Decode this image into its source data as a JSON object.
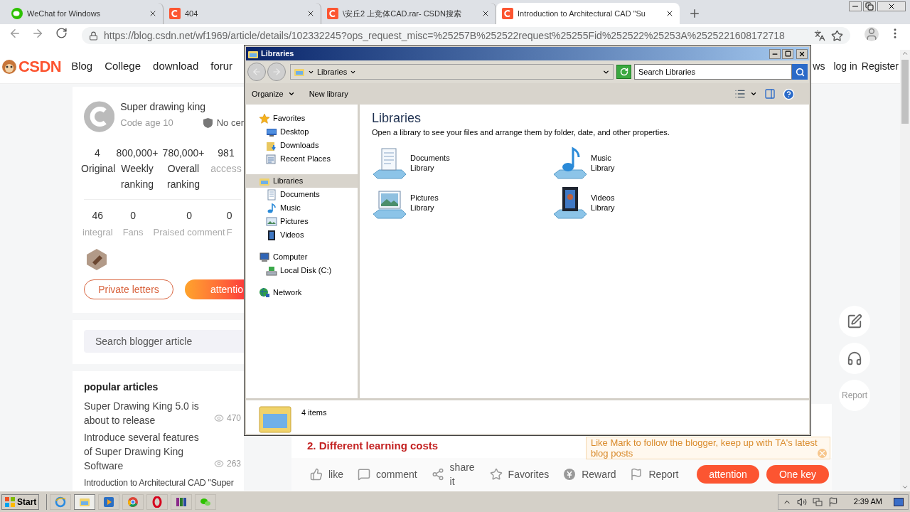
{
  "browser": {
    "tabs": [
      {
        "title": "WeChat for Windows",
        "kind": "wechat",
        "selected": false
      },
      {
        "title": "404",
        "kind": "csdn",
        "selected": false
      },
      {
        "title": "\\安丘2 上竞体CAD.rar- CSDN搜索",
        "kind": "csdn",
        "selected": false
      },
      {
        "title": "Introduction to Architectural CAD \"Su",
        "kind": "csdn",
        "selected": true
      }
    ],
    "address": "https://blog.csdn.net/wf1969/article/details/102332245?ops_request_misc=%25257B%252522request%25255Fid%252522%25253A%2525221608172718"
  },
  "site_header": {
    "logo": "CSDN",
    "nav": [
      "Blog",
      "College",
      "download",
      "forur"
    ],
    "right": [
      "ws",
      "log in",
      "Register"
    ]
  },
  "profile": {
    "name": "Super drawing king",
    "code_age": "Code age 10",
    "certification": "No cer",
    "stats": [
      {
        "value": "4",
        "label": "Original"
      },
      {
        "value": "800,000+",
        "label": "Weekly ranking"
      },
      {
        "value": "780,000+",
        "label": "Overall ranking"
      },
      {
        "value": "981",
        "label": "access"
      }
    ],
    "stats2": [
      {
        "value": "46",
        "label": "integral"
      },
      {
        "value": "0",
        "label": "Fans"
      },
      {
        "value": "0",
        "label": "Praised comment"
      },
      {
        "value": "0",
        "label": "F"
      }
    ],
    "buttons": [
      "Private letters",
      "attentio"
    ]
  },
  "blogger_search": {
    "placeholder": "Search blogger article"
  },
  "popular_articles": {
    "title": "popular articles",
    "items": [
      {
        "title": "Super Drawing King 5.0 is about to release",
        "views": "470"
      },
      {
        "title": "Introduce several features of Super Drawing King Software",
        "views": "263"
      },
      {
        "title": "Introduction to Architectural CAD \"Super"
      }
    ]
  },
  "article": {
    "heading": "2. Different learning costs",
    "tip": "Like Mark to follow the blogger, keep up with TA's latest blog posts",
    "actions": [
      {
        "label": "like",
        "kind": "like"
      },
      {
        "label": "comment",
        "kind": "comment"
      },
      {
        "label": "share it",
        "kind": "share"
      },
      {
        "label": "Favorites",
        "kind": "favorites"
      },
      {
        "label": "Reward",
        "kind": "reward"
      },
      {
        "label": "Report",
        "kind": "report"
      }
    ],
    "buttons": [
      "attention",
      "One key"
    ]
  },
  "right_rail": {
    "report": "Report"
  },
  "explorer": {
    "title": "Libraries",
    "breadcrumb": "Libraries",
    "search": {
      "placeholder": "Search Libraries"
    },
    "toolbar": [
      "Organize",
      "New library"
    ],
    "nav": [
      {
        "label": "Favorites",
        "kind": "star",
        "selected": false,
        "children": [
          {
            "label": "Desktop",
            "kind": "desktop",
            "selected": false
          },
          {
            "label": "Downloads",
            "kind": "downloads",
            "selected": false
          },
          {
            "label": "Recent Places",
            "kind": "recent",
            "selected": false
          }
        ]
      },
      {
        "label": "Libraries",
        "kind": "library",
        "selected": true,
        "children": [
          {
            "label": "Documents",
            "kind": "documents",
            "selected": false
          },
          {
            "label": "Music",
            "kind": "music",
            "selected": false
          },
          {
            "label": "Pictures",
            "kind": "pictures",
            "selected": false
          },
          {
            "label": "Videos",
            "kind": "videos",
            "selected": false
          }
        ]
      },
      {
        "label": "Computer",
        "kind": "computer",
        "selected": false,
        "children": [
          {
            "label": "Local Disk (C:)",
            "kind": "disk",
            "selected": false
          }
        ]
      },
      {
        "label": "Network",
        "kind": "network",
        "selected": false
      }
    ],
    "heading": "Libraries",
    "description": "Open a library to see your files and arrange them by folder, date, and other properties.",
    "libraries": [
      {
        "name": "Documents",
        "type": "Library",
        "kind": "documents"
      },
      {
        "name": "Music",
        "type": "Library",
        "kind": "music"
      },
      {
        "name": "Pictures",
        "type": "Library",
        "kind": "pictures"
      },
      {
        "name": "Videos",
        "type": "Library",
        "kind": "videos"
      }
    ],
    "status": "4 items"
  },
  "taskbar": {
    "start": "Start",
    "apps": [
      {
        "kind": "ie",
        "selected": false
      },
      {
        "kind": "explorer",
        "selected": true
      },
      {
        "kind": "media",
        "selected": false
      },
      {
        "kind": "chrome",
        "selected": false
      },
      {
        "kind": "opera",
        "selected": false
      },
      {
        "kind": "winrar",
        "selected": false
      },
      {
        "kind": "wechat",
        "selected": false
      }
    ],
    "clock": "2:39 AM"
  }
}
